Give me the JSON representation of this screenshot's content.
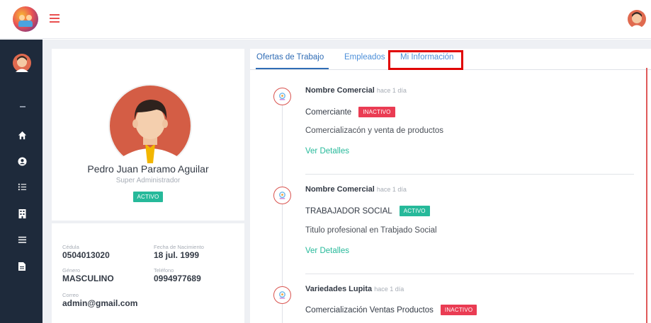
{
  "colors": {
    "sidebar_bg": "#1e2a3b",
    "content_bg": "#eef0f4",
    "tab_link": "#4c8fd9",
    "badge_active": "#26b99a",
    "badge_inactive": "#ea3c53",
    "link_green": "#26b99a",
    "highlight_box": "#e00000"
  },
  "header": {
    "logo_icon": "kids-logo-icon",
    "menu_icon": "hamburger-icon",
    "user_avatar_icon": "user-avatar-icon"
  },
  "sidebar": {
    "avatar_icon": "user-avatar-icon",
    "items": [
      {
        "icon": "home-icon"
      },
      {
        "icon": "user-circle-icon"
      },
      {
        "icon": "list-check-icon"
      },
      {
        "icon": "building-icon"
      },
      {
        "icon": "list-icon"
      },
      {
        "icon": "file-icon"
      }
    ]
  },
  "profile": {
    "name": "Pedro Juan Paramo Aguilar",
    "role": "Super Administrador",
    "status": "ACTIVO",
    "fields": {
      "cedula": {
        "label": "Cédula",
        "value": "0504013020"
      },
      "fecha": {
        "label": "Fecha de Nacimiento",
        "value": "18 jul. 1999"
      },
      "genero": {
        "label": "Género",
        "value": "MASCULINO"
      },
      "telefono": {
        "label": "Teléfono",
        "value": "0994977689"
      },
      "correo": {
        "label": "Correo",
        "value": "admin@gmail.com"
      }
    }
  },
  "tabs": [
    {
      "label": "Ofertas de Trabajo",
      "active": true
    },
    {
      "label": "Empleados",
      "active": false
    },
    {
      "label": "Mi Información",
      "active": false
    }
  ],
  "timeline": [
    {
      "company": "Nombre Comercial",
      "time": "hace 1 día",
      "title": "Comerciante",
      "status": "INACTIVO",
      "description": "Comercializacón y venta de productos",
      "link": "Ver Detalles"
    },
    {
      "company": "Nombre Comercial",
      "time": "hace 1 día",
      "title": "TRABAJADOR SOCIAL",
      "status": "ACTIVO",
      "description": "Titulo profesional en Trabjado Social",
      "link": "Ver Detalles"
    },
    {
      "company": "Variedades Lupita",
      "time": "hace 1 día",
      "title": "Comercialización Ventas Productos",
      "status": "INACTIVO"
    }
  ]
}
